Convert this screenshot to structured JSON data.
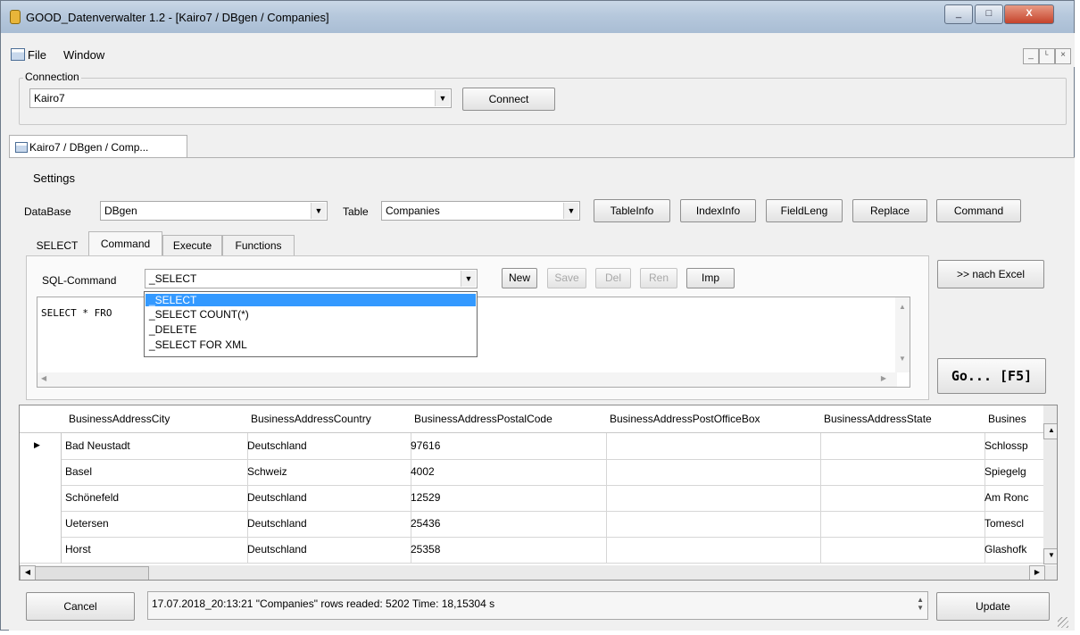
{
  "window": {
    "title": "GOOD_Datenverwalter 1.2 - [Kairo7 / DBgen / Companies]",
    "minimize_glyph": "_",
    "maximize_glyph": "□",
    "close_glyph": "X"
  },
  "menu": {
    "file": "File",
    "window": "Window"
  },
  "mdi": {
    "minimize": "_",
    "restore": "ᴸ",
    "close": "×"
  },
  "connection": {
    "legend": "Connection",
    "value": "Kairo7",
    "connect_label": "Connect"
  },
  "doc_tab": {
    "label": "Kairo7 / DBgen / Comp..."
  },
  "settings": {
    "label": "Settings",
    "database_label": "DataBase",
    "database_value": "DBgen",
    "table_label": "Table",
    "table_value": "Companies",
    "buttons": {
      "tableinfo": "TableInfo",
      "indexinfo": "IndexInfo",
      "fieldleng": "FieldLeng",
      "replace": "Replace",
      "command": "Command"
    }
  },
  "tabs": {
    "select": "SELECT",
    "command": "Command",
    "execute": "Execute",
    "functions": "Functions"
  },
  "sql": {
    "label": "SQL-Command",
    "value": "_SELECT",
    "text": "SELECT * FRO",
    "buttons": {
      "new": "New",
      "save": "Save",
      "del": "Del",
      "ren": "Ren",
      "imp": "Imp"
    },
    "options": [
      "_SELECT",
      "_SELECT COUNT(*)",
      "_DELETE",
      "_SELECT FOR XML"
    ]
  },
  "actions": {
    "excel": ">> nach Excel",
    "go": "Go... [F5]"
  },
  "grid": {
    "columns": [
      "BusinessAddressCity",
      "BusinessAddressCountry",
      "BusinessAddressPostalCode",
      "BusinessAddressPostOfficeBox",
      "BusinessAddressState",
      "Busines"
    ],
    "current_row_marker": "▶",
    "rows": [
      [
        "Bad Neustadt",
        "Deutschland",
        "97616",
        "",
        "",
        "Schlossp"
      ],
      [
        "Basel",
        "Schweiz",
        "4002",
        "",
        "",
        "Spiegelg"
      ],
      [
        "Schönefeld",
        "Deutschland",
        "12529",
        "",
        "",
        "Am Ronc"
      ],
      [
        "Uetersen",
        "Deutschland",
        "25436",
        "",
        "",
        "Tomescl"
      ],
      [
        "Horst",
        "Deutschland",
        "25358",
        "",
        "",
        "Glashofk"
      ]
    ]
  },
  "bottom": {
    "cancel": "Cancel",
    "status": "17.07.2018_20:13:21 \"Companies\" rows readed: 5202  Time: 18,15304 s",
    "update": "Update"
  },
  "icons": {
    "app": "app-icon",
    "doc": "document-icon",
    "dropdown": "▼",
    "scroll_up": "▲",
    "scroll_down": "▼",
    "scroll_left": "◀",
    "scroll_right": "▶"
  }
}
